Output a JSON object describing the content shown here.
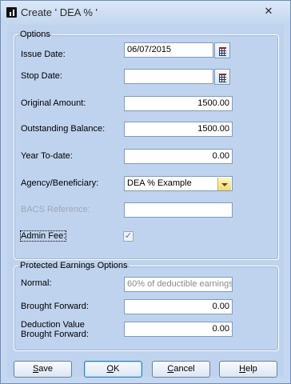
{
  "window": {
    "title": "Create ' DEA % '",
    "close_glyph": "✕"
  },
  "options": {
    "legend": "Options",
    "issue_date": {
      "label": "Issue Date:",
      "value": "06/07/2015"
    },
    "stop_date": {
      "label": "Stop Date:",
      "value": ""
    },
    "original_amount": {
      "label": "Original Amount:",
      "value": "1500.00"
    },
    "outstanding_balance": {
      "label": "Outstanding Balance:",
      "value": "1500.00"
    },
    "year_to_date": {
      "label": "Year To-date:",
      "value": "0.00"
    },
    "agency": {
      "label": "Agency/Beneficiary:",
      "value": "DEA % Example"
    },
    "bacs_reference": {
      "label": "BACS Reference:",
      "value": ""
    },
    "admin_fee": {
      "label": "Admin Fee:",
      "check_glyph": "✓",
      "checked": true
    }
  },
  "protected": {
    "legend": "Protected Earnings Options",
    "normal": {
      "label": "Normal:",
      "value": "60% of deductible earnings"
    },
    "brought_forward": {
      "label": "Brought Forward:",
      "value": "0.00"
    },
    "deduction_value": {
      "label_line1": "Deduction Value",
      "label_line2": "Brought Forward:",
      "value": "0.00"
    }
  },
  "buttons": {
    "save": {
      "key": "S",
      "rest": "ave"
    },
    "ok": {
      "key": "O",
      "rest": "K"
    },
    "cancel": {
      "key": "C",
      "rest": "ancel"
    },
    "help": {
      "key": "H",
      "rest": "elp"
    }
  },
  "colors": {
    "title_bar": "#dbe8f8",
    "client_bg": "#bfd3ee",
    "field_border": "#7f9db9",
    "dropdown_accent": "#f5d86a"
  },
  "icons": {
    "app": "app-icon",
    "calendar": "calendar-icon",
    "dropdown": "chevron-down-icon",
    "check": "check-icon"
  }
}
